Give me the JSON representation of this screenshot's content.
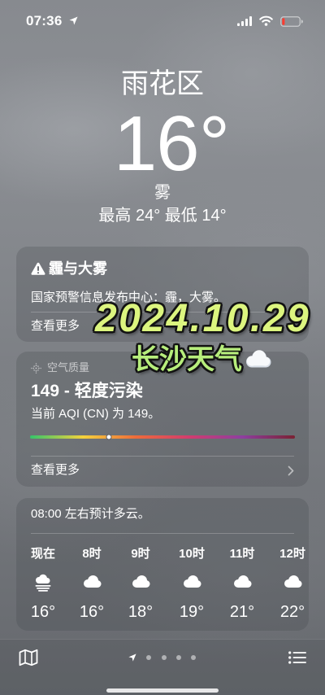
{
  "status_bar": {
    "time": "07:36",
    "icons": [
      "location-arrow-icon",
      "signal-icon",
      "wifi-icon",
      "battery-icon"
    ],
    "battery_level": 0.15
  },
  "header": {
    "location": "雨花区",
    "temperature": "16°",
    "condition": "雾",
    "high": "最高 24°",
    "low": "最低 14°"
  },
  "alert": {
    "icon": "warning-icon",
    "title": "霾与大雾",
    "source": "国家预警信息发布中心：霾，大雾。",
    "more": "查看更多"
  },
  "overlay": {
    "date": "2024.10.29",
    "caption": "长沙天气",
    "caption_icon": "cloud-icon"
  },
  "air_quality": {
    "icon": "air-quality-icon",
    "label": "空气质量",
    "headline": "149 - 轻度污染",
    "description": "当前 AQI (CN) 为 149。",
    "aqi": 149,
    "scale_colors": [
      "#35c46a",
      "#f4d23c",
      "#ee6b3a",
      "#d23c6e",
      "#8e3ea0",
      "#7b2233"
    ],
    "more": "查看更多",
    "more_icon": "chevron-right-icon"
  },
  "hourly": {
    "summary": "08:00 左右预计多云。",
    "hours": [
      {
        "label": "现在",
        "icon": "fog-icon",
        "temp": "16°"
      },
      {
        "label": "8时",
        "icon": "cloud-icon",
        "temp": "16°"
      },
      {
        "label": "9时",
        "icon": "cloud-icon",
        "temp": "18°"
      },
      {
        "label": "10时",
        "icon": "cloud-icon",
        "temp": "19°"
      },
      {
        "label": "11时",
        "icon": "cloud-icon",
        "temp": "21°"
      },
      {
        "label": "12时",
        "icon": "cloud-icon",
        "temp": "22°"
      }
    ]
  },
  "toolbar": {
    "map_icon": "map-icon",
    "list_icon": "list-icon",
    "page_indicator": {
      "current_icon": "location-arrow-icon",
      "current": 1,
      "total": 5
    }
  },
  "colors": {
    "battery_low": "#ff3b30",
    "overlay_date": "#dcf57f",
    "overlay_caption": "#b7ee7c"
  }
}
